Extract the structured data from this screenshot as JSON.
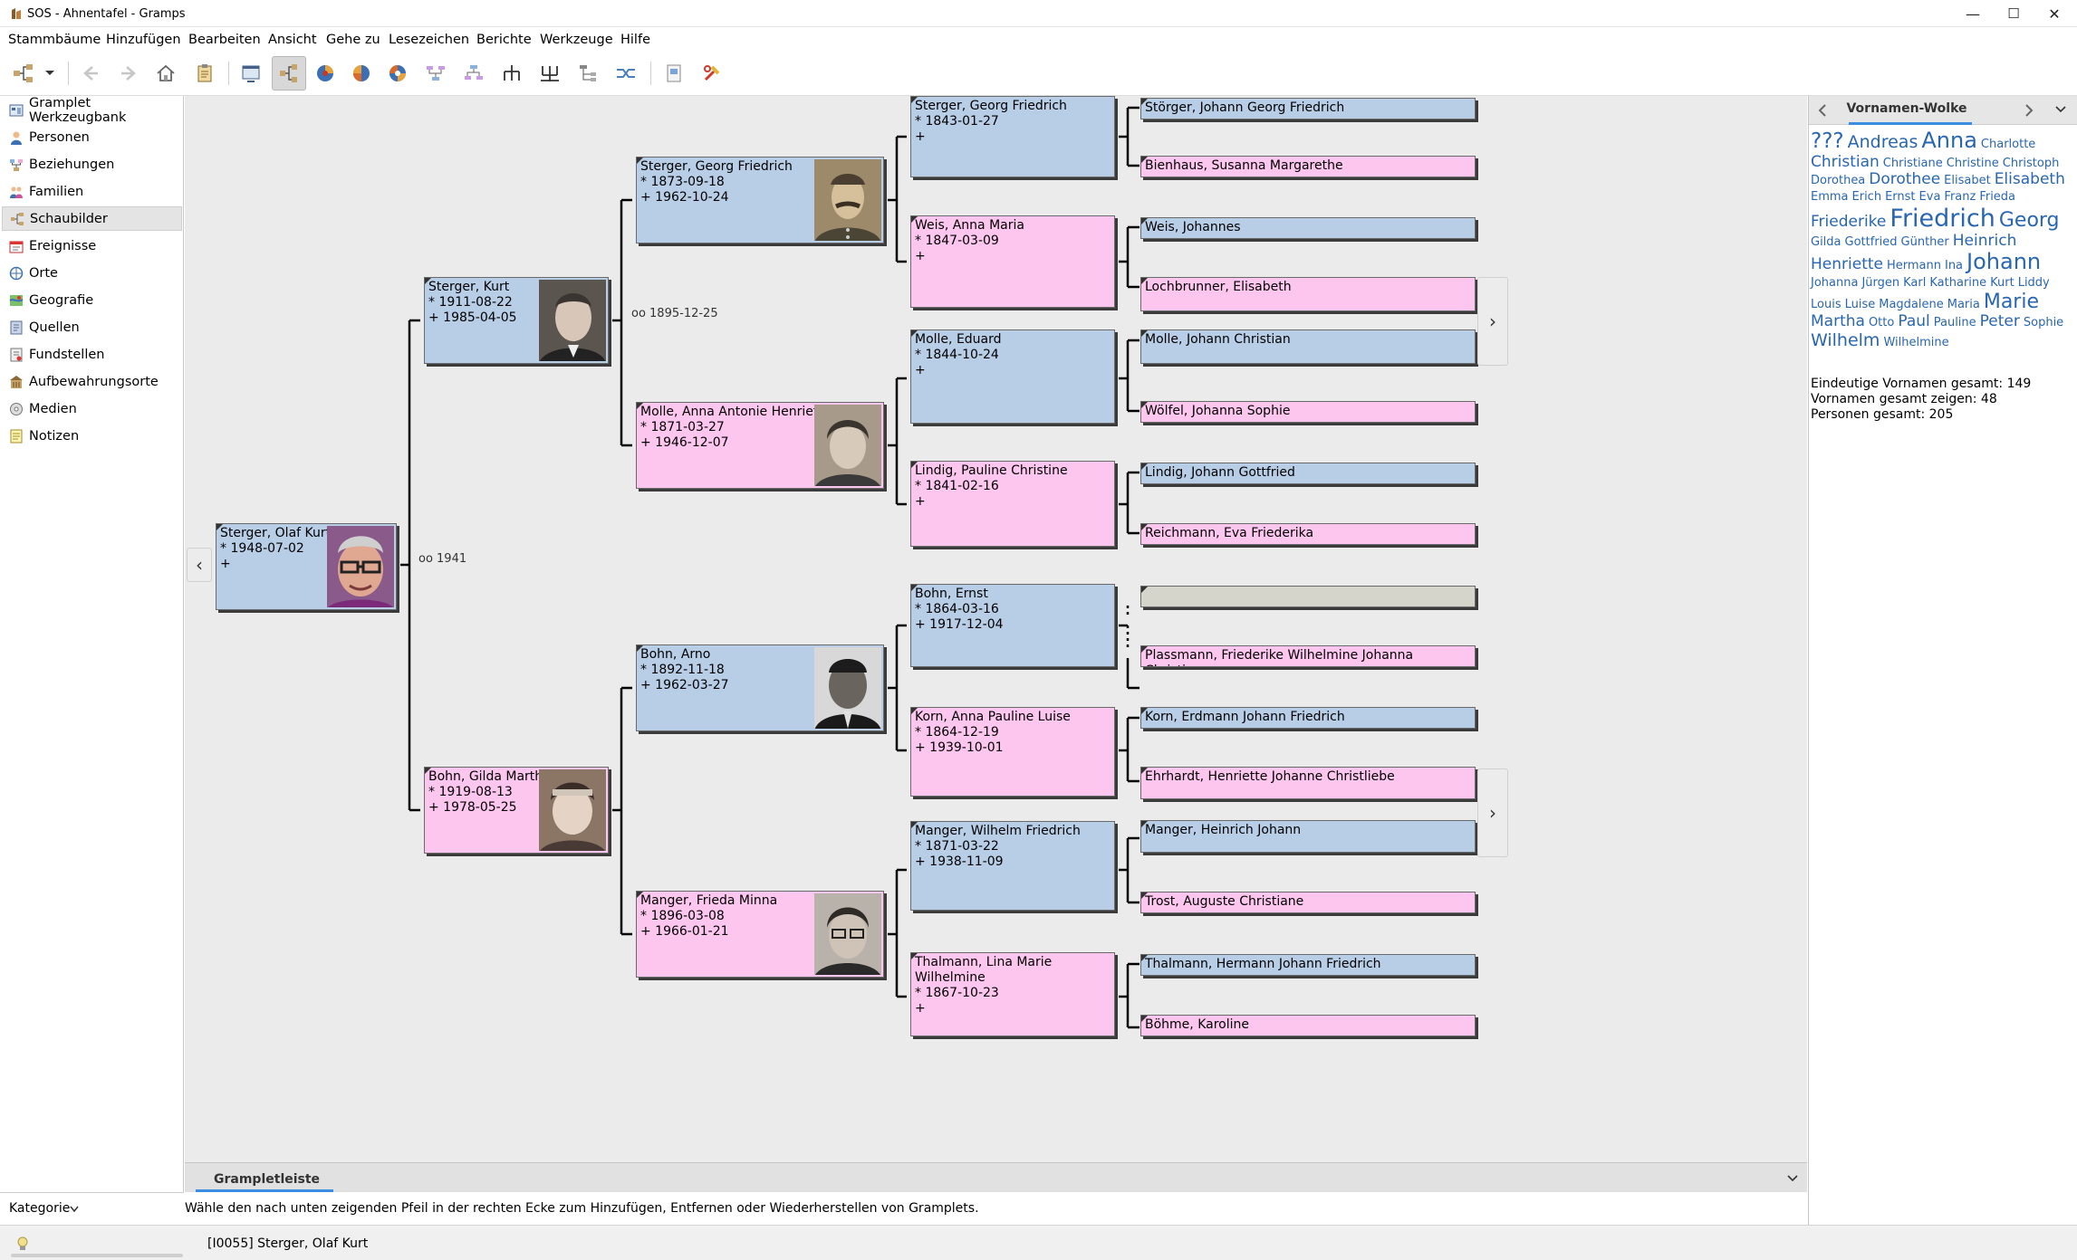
{
  "window": {
    "title": "SOS - Ahnentafel - Gramps",
    "minimize": "—",
    "maximize": "☐",
    "close": "✕"
  },
  "menu": [
    "Stammbäume",
    "Hinzufügen",
    "Bearbeiten",
    "Ansicht",
    "Gehe zu",
    "Lesezeichen",
    "Berichte",
    "Werkzeuge",
    "Hilfe"
  ],
  "sidebar": {
    "items": [
      "Gramplet Werkzeugbank",
      "Personen",
      "Beziehungen",
      "Familien",
      "Schaubilder",
      "Ereignisse",
      "Orte",
      "Geografie",
      "Quellen",
      "Fundstellen",
      "Aufbewahrungsorte",
      "Medien",
      "Notizen"
    ],
    "selected": "Schaubilder",
    "category": "Kategorie"
  },
  "chart": {
    "people": [
      {
        "name": "Sterger, Olaf Kurt",
        "birth": "* 1948-07-02",
        "death": "+"
      },
      {
        "name": "Sterger, Kurt",
        "birth": "* 1911-08-22",
        "death": "+ 1985-04-05"
      },
      {
        "name": "Bohn, Gilda Martha",
        "birth": "* 1919-08-13",
        "death": "+ 1978-05-25"
      },
      {
        "name": "Sterger, Georg Friedrich",
        "birth": "* 1873-09-18",
        "death": "+ 1962-10-24"
      },
      {
        "name": "Molle, Anna Antonie Henriette",
        "birth": "* 1871-03-27",
        "death": "+ 1946-12-07"
      },
      {
        "name": "Bohn, Arno",
        "birth": "* 1892-11-18",
        "death": "+ 1962-03-27"
      },
      {
        "name": "Manger, Frieda Minna",
        "birth": "* 1896-03-08",
        "death": "+ 1966-01-21"
      },
      {
        "name": "Sterger, Georg Friedrich",
        "birth": "* 1843-01-27",
        "death": "+"
      },
      {
        "name": "Weis, Anna Maria",
        "birth": "* 1847-03-09",
        "death": "+"
      },
      {
        "name": "Molle, Eduard",
        "birth": "* 1844-10-24",
        "death": "+"
      },
      {
        "name": "Lindig, Pauline Christine",
        "birth": "* 1841-02-16",
        "death": "+"
      },
      {
        "name": "Bohn, Ernst",
        "birth": "* 1864-03-16",
        "death": "+ 1917-12-04"
      },
      {
        "name": "Korn, Anna Pauline Luise",
        "birth": "* 1864-12-19",
        "death": "+ 1939-10-01"
      },
      {
        "name": "Manger, Wilhelm Friedrich",
        "birth": "* 1871-03-22",
        "death": "+ 1938-11-09"
      },
      {
        "name": "Thalmann, Lina Marie Wilhelmine",
        "birth": "* 1867-10-23",
        "death": "+"
      },
      {
        "name": "Störger, Johann Georg Friedrich"
      },
      {
        "name": "Bienhaus, Susanna Margarethe"
      },
      {
        "name": "Weis, Johannes"
      },
      {
        "name": "Lochbrunner, Elisabeth"
      },
      {
        "name": "Molle, Johann Christian"
      },
      {
        "name": "Wölfel, Johanna Sophie"
      },
      {
        "name": "Lindig, Johann Gottfried"
      },
      {
        "name": "Reichmann, Eva Friederika"
      },
      {
        "name": ""
      },
      {
        "name": "Plassmann, Friederike Wilhelmine Johanna Christiane"
      },
      {
        "name": "Korn, Erdmann Johann Friedrich"
      },
      {
        "name": "Ehrhardt, Henriette Johanne Christliebe"
      },
      {
        "name": "Manger, Heinrich Johann"
      },
      {
        "name": "Trost, Auguste Christiane"
      },
      {
        "name": "Thalmann, Hermann Johann Friedrich"
      },
      {
        "name": "Böhme, Karoline"
      }
    ],
    "marriages": [
      "oo 1941",
      "oo 1895-12-25"
    ]
  },
  "gramplet_bar": {
    "tab": "Grampletleiste",
    "message": "Wähle den nach unten zeigenden Pfeil in der rechten Ecke zum Hinzufügen, Entfernen oder Wiederherstellen von Gramplets."
  },
  "right_panel": {
    "tab": "Vornamen-Wolke",
    "cloud": [
      "???",
      "Andreas",
      "Anna",
      "Charlotte",
      "Christian",
      "Christiane",
      "Christine",
      "Christoph",
      "Dorothea",
      "Dorothee",
      "Elisabet",
      "Elisabeth",
      "Emma",
      "Erich",
      "Ernst",
      "Eva",
      "Franz",
      "Frieda",
      "Friederike",
      "Friedrich",
      "Georg",
      "Gilda",
      "Gottfried",
      "Günther",
      "Heinrich",
      "Henriette",
      "Hermann",
      "Ina",
      "Johann",
      "Johanna",
      "Jürgen",
      "Karl",
      "Katharine",
      "Kurt",
      "Liddy",
      "Louis",
      "Luise",
      "Magdalene",
      "Maria",
      "Marie",
      "Martha",
      "Otto",
      "Paul",
      "Pauline",
      "Peter",
      "Sophie",
      "Wilhelm",
      "Wilhelmine"
    ],
    "stats": [
      "Eindeutige Vornamen gesamt: 149",
      "Vornamen gesamt zeigen: 48",
      "Personen gesamt: 205"
    ]
  },
  "status": {
    "text": "[I0055] Sterger, Olaf Kurt"
  },
  "colors": {
    "male": "#b8cde6",
    "female": "#fcc6ef",
    "unknown": "#d5d5cc",
    "accent": "#3b8de0",
    "cloud": "#2866b2"
  }
}
